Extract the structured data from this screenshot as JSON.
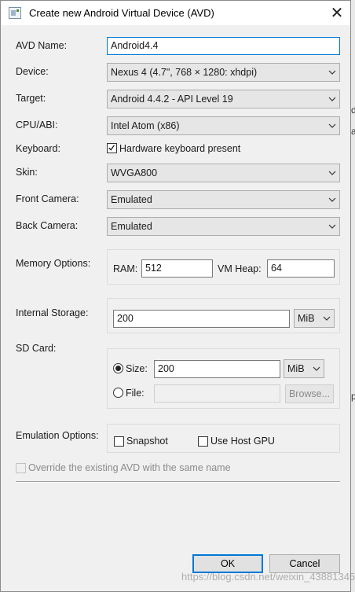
{
  "window": {
    "title": "Create new Android Virtual Device (AVD)",
    "close_symbol": "✕"
  },
  "form": {
    "avd_name": {
      "label": "AVD Name:",
      "value": "Android4.4"
    },
    "device": {
      "label": "Device:",
      "value": "Nexus 4 (4.7\", 768 × 1280: xhdpi)"
    },
    "target": {
      "label": "Target:",
      "value": "Android 4.4.2 - API Level 19"
    },
    "cpu_abi": {
      "label": "CPU/ABI:",
      "value": "Intel Atom (x86)"
    },
    "keyboard": {
      "label": "Keyboard:",
      "checkbox_label": "Hardware keyboard present",
      "checked": true
    },
    "skin": {
      "label": "Skin:",
      "value": "WVGA800"
    },
    "front_camera": {
      "label": "Front Camera:",
      "value": "Emulated"
    },
    "back_camera": {
      "label": "Back Camera:",
      "value": "Emulated"
    },
    "memory": {
      "label": "Memory Options:",
      "ram_label": "RAM:",
      "ram_value": "512",
      "vm_heap_label": "VM Heap:",
      "vm_heap_value": "64"
    },
    "internal_storage": {
      "label": "Internal Storage:",
      "value": "200",
      "unit": "MiB"
    },
    "sd_card": {
      "label": "SD Card:",
      "size_label": "Size:",
      "size_value": "200",
      "size_unit": "MiB",
      "file_label": "File:",
      "file_value": "",
      "browse_label": "Browse...",
      "selected": "size"
    },
    "emulation": {
      "label": "Emulation Options:",
      "snapshot_label": "Snapshot",
      "snapshot_checked": false,
      "host_gpu_label": "Use Host GPU",
      "host_gpu_checked": false
    },
    "override": {
      "label": "Override the existing AVD with the same name",
      "checked": false
    }
  },
  "buttons": {
    "ok": "OK",
    "cancel": "Cancel"
  },
  "background_fragments": [
    "d",
    "ar",
    "pi"
  ],
  "watermark": "https://blog.csdn.net/weixin_43881345",
  "colors": {
    "focus_accent": "#0078d7",
    "dialog_bg": "#f0f0f0"
  }
}
